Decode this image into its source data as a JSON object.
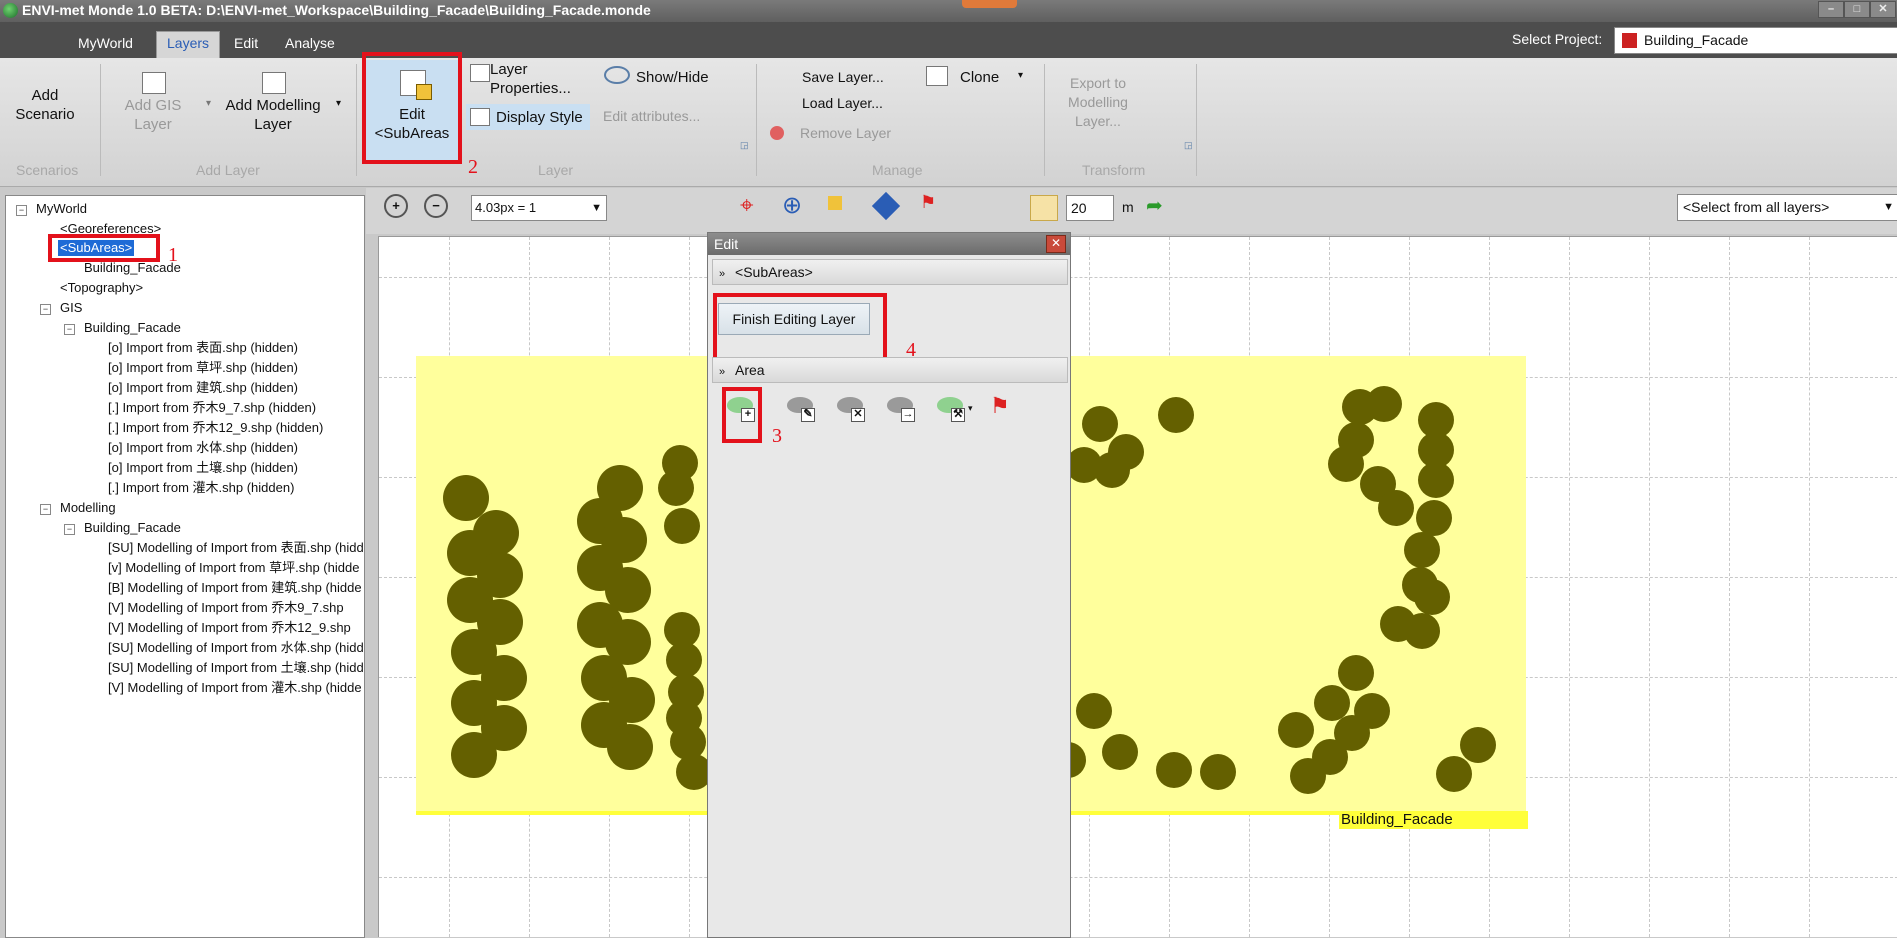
{
  "window": {
    "title": "ENVI-met Monde 1.0 BETA: D:\\ENVI-met_Workspace\\Building_Facade\\Building_Facade.monde"
  },
  "menu": {
    "tabs": [
      "MyWorld",
      "Layers",
      "Edit",
      "Analyse"
    ],
    "active": "Layers"
  },
  "project": {
    "label": "Select Project:",
    "value": "Building_Facade"
  },
  "ribbon": {
    "add_scenario": "Add\nScenario",
    "add_gis_layer": "Add GIS\nLayer",
    "add_modelling_layer": "Add Modelling\nLayer",
    "edit_subareas": "Edit\n<SubAreas",
    "layer_properties": "Layer\nProperties...",
    "display_style": "Display Style",
    "show_hide": "Show/Hide",
    "edit_attributes": "Edit attributes...",
    "save_layer": "Save Layer...",
    "load_layer": "Load Layer...",
    "remove_layer": "Remove Layer",
    "clone": "Clone",
    "export_to_modelling": "Export to\nModelling\nLayer...",
    "groups": [
      "Scenarios",
      "Add Layer",
      "Layer",
      "Manage",
      "Transform"
    ]
  },
  "annotations": {
    "n1": "1",
    "n2": "2",
    "n3": "3",
    "n4": "4"
  },
  "tree": {
    "root": "MyWorld",
    "georef": "<Georeferences>",
    "subareas": "<SubAreas>",
    "subarea_child": "Building_Facade",
    "topography": "<Topography>",
    "gis": "GIS",
    "gis_child": "Building_Facade",
    "gis_items": [
      "[o] Import from 表面.shp (hidden)",
      "[o] Import from 草坪.shp (hidden)",
      "[o] Import from 建筑.shp (hidden)",
      "[.] Import from 乔木9_7.shp (hidden)",
      "[.] Import from 乔木12_9.shp (hidden)",
      "[o] Import from 水体.shp (hidden)",
      "[o] Import from 土壤.shp (hidden)",
      "[.] Import from 灌木.shp (hidden)"
    ],
    "modelling": "Modelling",
    "modelling_child": "Building_Facade",
    "modelling_items": [
      "[SU] Modelling of Import from 表面.shp (hidde",
      "[v] Modelling of Import from 草坪.shp (hidde",
      "[B] Modelling of Import from 建筑.shp (hidde",
      "[V] Modelling of Import from 乔木9_7.shp",
      "[V] Modelling of Import from 乔木12_9.shp",
      "[SU] Modelling of Import from 水体.shp (hidd",
      "[SU] Modelling of Import from 土壤.shp (hidd",
      "[V] Modelling of Import from 灌木.shp (hidde"
    ]
  },
  "map_toolbar": {
    "zoom_value": "4.03px = 1",
    "grid_value": "20",
    "grid_unit": "m",
    "layer_select": "<Select from all layers>"
  },
  "map": {
    "layer_label": "Building_Facade",
    "fill_color": "#ffff9c",
    "tree_color": "#646000"
  },
  "edit_panel": {
    "title": "Edit",
    "section1": "<SubAreas>",
    "finish_button": "Finish Editing Layer",
    "section2": "Area"
  }
}
